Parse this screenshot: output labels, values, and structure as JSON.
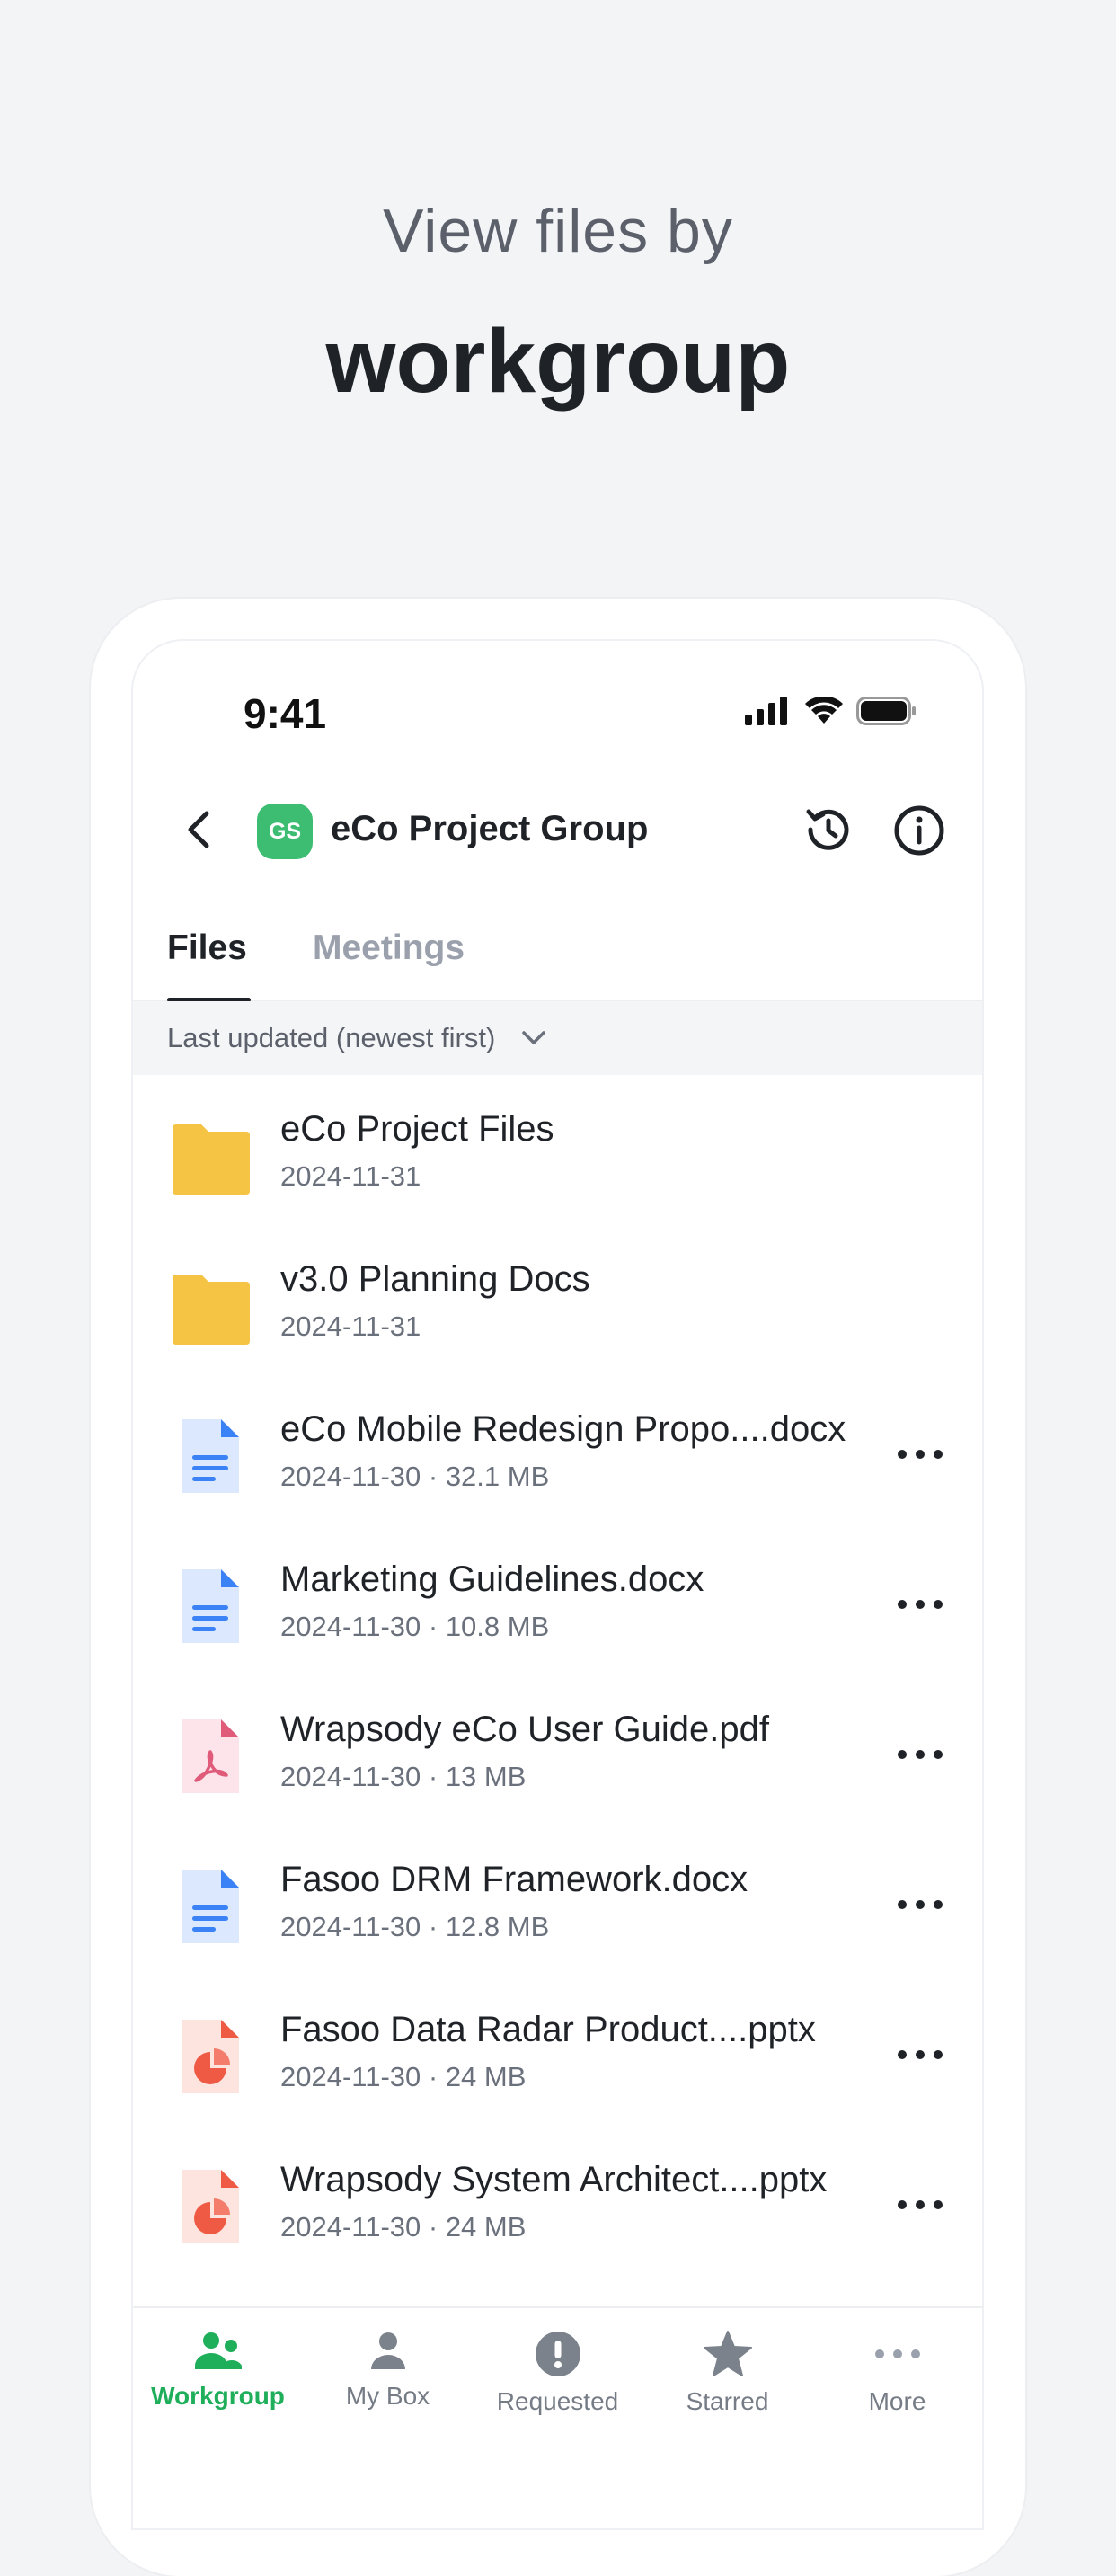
{
  "hero": {
    "subtitle": "View files by",
    "title": "workgroup"
  },
  "status_bar": {
    "time": "9:41",
    "icons": [
      "cellular-signal-icon",
      "wifi-icon",
      "battery-icon"
    ]
  },
  "header": {
    "back_icon": "chevron-left-icon",
    "avatar_initials": "GS",
    "avatar_color": "#3dbd72",
    "title": "eCo Project Group",
    "actions": [
      "history-icon",
      "info-icon"
    ]
  },
  "tabs": [
    {
      "label": "Files",
      "active": true
    },
    {
      "label": "Meetings",
      "active": false
    }
  ],
  "sort": {
    "label": "Last updated (newest first)",
    "icon": "chevron-down-icon"
  },
  "items": [
    {
      "kind": "folder",
      "name": "eCo Project Files",
      "meta": "2024-11-31"
    },
    {
      "kind": "folder",
      "name": "v3.0 Planning Docs",
      "meta": "2024-11-31"
    },
    {
      "kind": "docx",
      "name": "eCo Mobile Redesign Propo....docx",
      "meta": "2024-11-30 · 32.1 MB"
    },
    {
      "kind": "docx",
      "name": "Marketing Guidelines.docx",
      "meta": "2024-11-30 · 10.8 MB"
    },
    {
      "kind": "pdf",
      "name": "Wrapsody eCo User Guide.pdf",
      "meta": "2024-11-30 · 13 MB"
    },
    {
      "kind": "docx",
      "name": "Fasoo DRM Framework.docx",
      "meta": "2024-11-30 · 12.8 MB"
    },
    {
      "kind": "pptx",
      "name": "Fasoo Data Radar Product....pptx",
      "meta": "2024-11-30 · 24 MB"
    },
    {
      "kind": "pptx",
      "name": "Wrapsody System Architect....pptx",
      "meta": "2024-11-30 · 24 MB"
    }
  ],
  "bottom_nav": [
    {
      "label": "Workgroup",
      "icon": "people-icon",
      "active": true
    },
    {
      "label": "My Box",
      "icon": "person-icon",
      "active": false
    },
    {
      "label": "Requested",
      "icon": "exclamation-badge-icon",
      "active": false
    },
    {
      "label": "Starred",
      "icon": "star-icon",
      "active": false
    },
    {
      "label": "More",
      "icon": "ellipsis-icon",
      "active": false
    }
  ],
  "colors": {
    "accent_green": "#1fae5a",
    "folder": "#f5c445",
    "docx": "#3b82f6",
    "pdf": "#e05a7a",
    "pptx": "#ef5a44"
  }
}
